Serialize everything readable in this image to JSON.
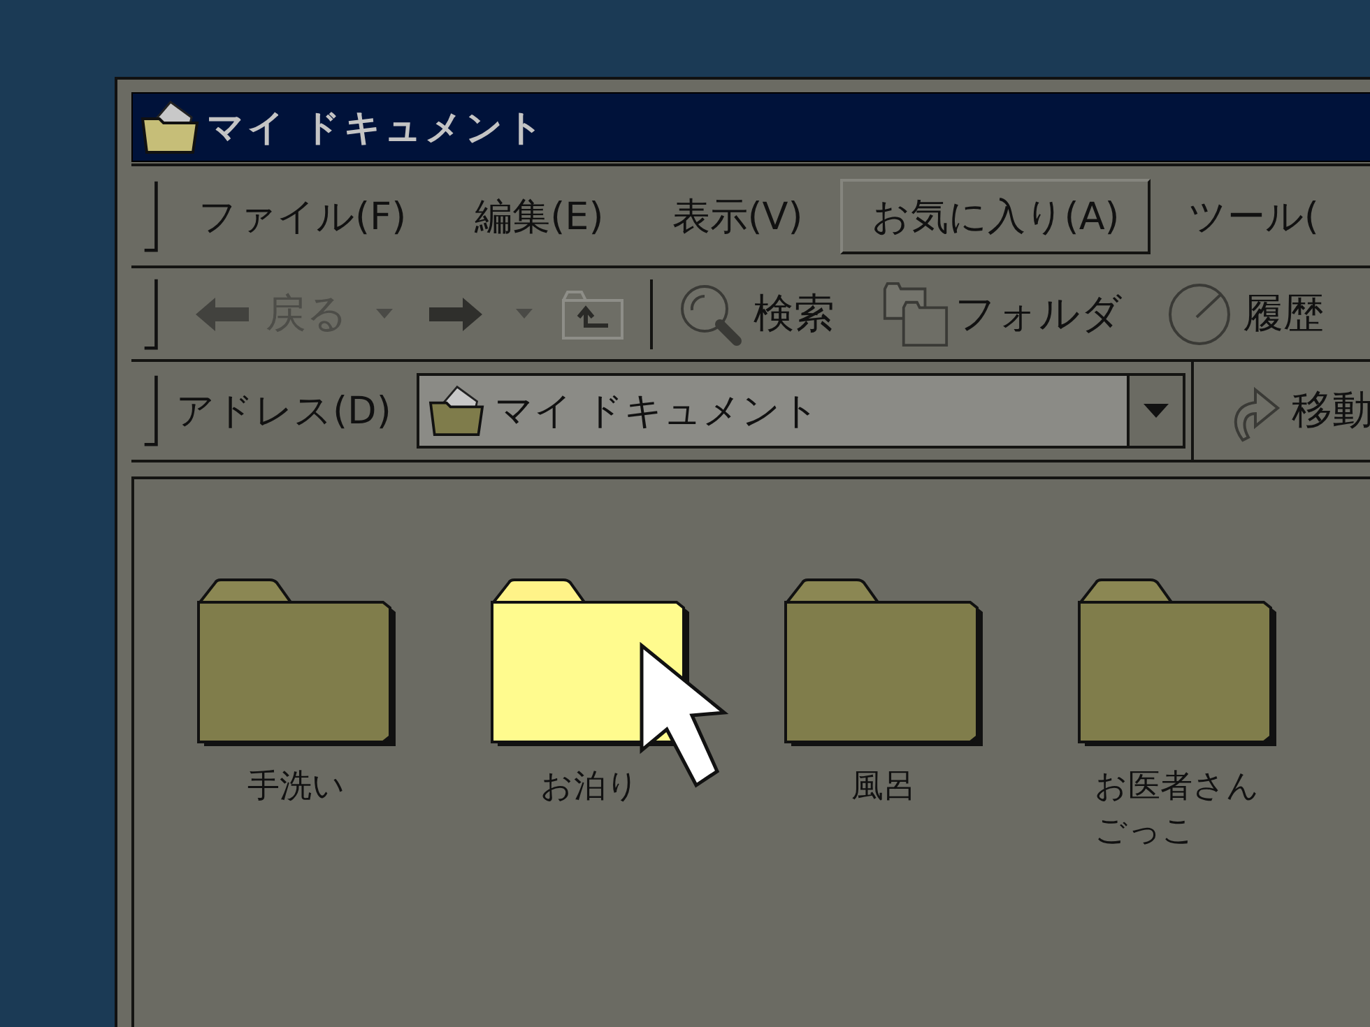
{
  "window": {
    "title": "マイ ドキュメント"
  },
  "menu": [
    {
      "label": "ファイル(F)",
      "selected": false
    },
    {
      "label": "編集(E)",
      "selected": false
    },
    {
      "label": "表示(V)",
      "selected": false
    },
    {
      "label": "お気に入り(A)",
      "selected": true
    },
    {
      "label": "ツール(",
      "selected": false
    }
  ],
  "toolbar": [
    {
      "kind": "back",
      "label": "戻る",
      "disabled": true
    },
    {
      "kind": "forward",
      "disabled": false
    },
    {
      "kind": "up",
      "disabled": false
    },
    {
      "kind": "separator"
    },
    {
      "kind": "search",
      "label": "検索",
      "disabled": false
    },
    {
      "kind": "folders",
      "label": "フォルダ",
      "disabled": false
    },
    {
      "kind": "history",
      "label": "履歴",
      "disabled": false
    }
  ],
  "address": {
    "label": "アドレス(D)",
    "value": "マイ ドキュメント",
    "go": "移動"
  },
  "folders": [
    {
      "name": "手洗い",
      "selected": false
    },
    {
      "name": "お泊り",
      "selected": true
    },
    {
      "name": "風呂",
      "selected": false
    },
    {
      "name": "お医者さんごっこ",
      "selected": false
    }
  ]
}
